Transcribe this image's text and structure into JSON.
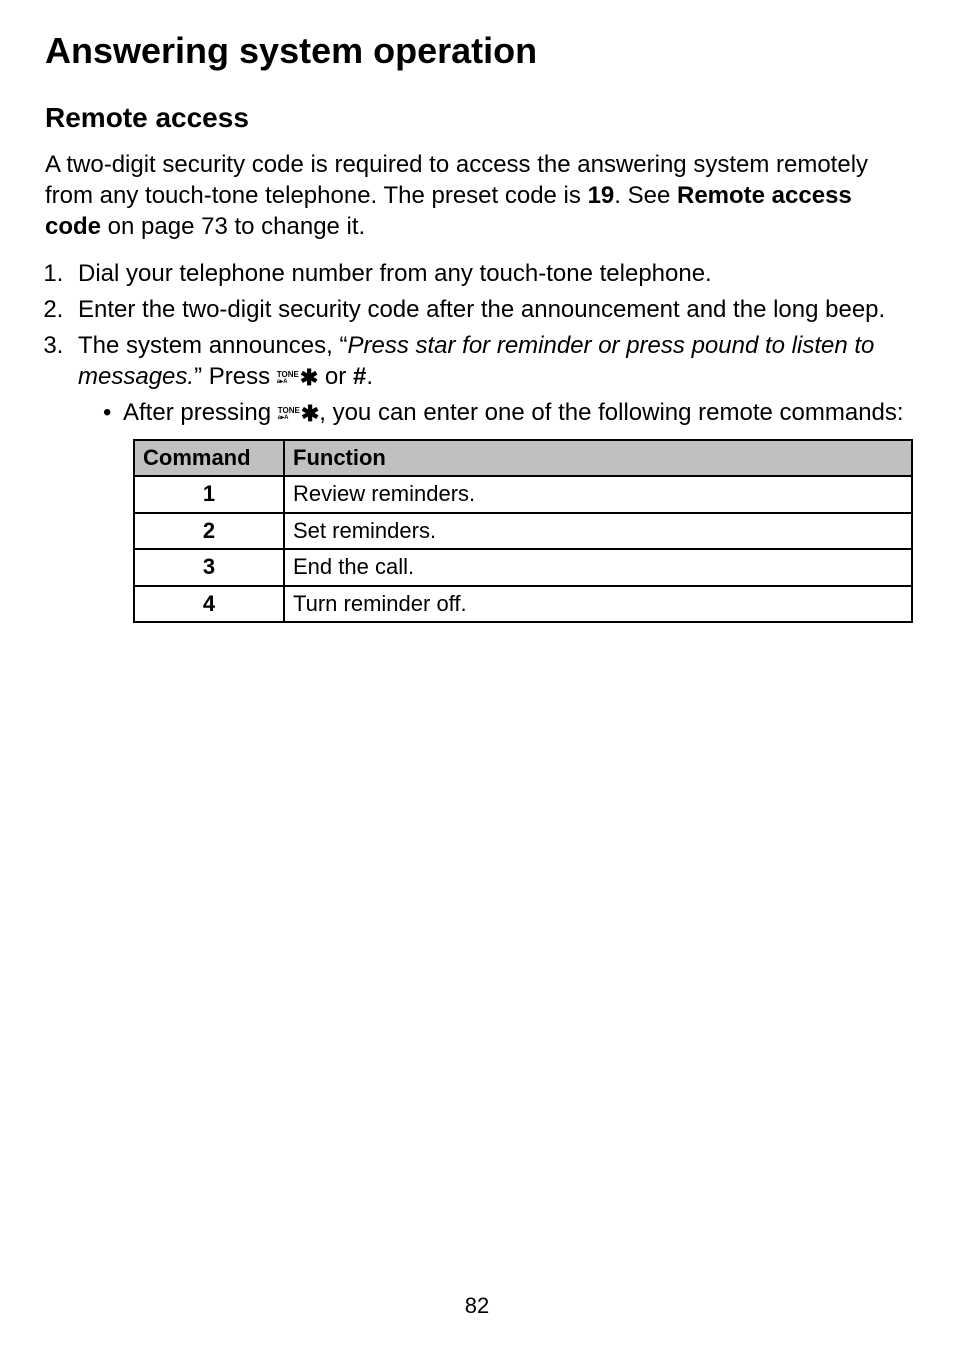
{
  "page": {
    "title": "Answering system operation",
    "number": "82"
  },
  "section": {
    "title": "Remote access",
    "intro_part1": "A two-digit security code is required to access the answering system remotely from any touch-tone telephone. The preset code is ",
    "intro_code": "19",
    "intro_part2": ". See ",
    "intro_ref": "Remote access code",
    "intro_part3": " on page 73 to change it."
  },
  "steps": {
    "1": "Dial your telephone number from any touch-tone telephone.",
    "2": "Enter the two-digit security code after the announcement and the long beep.",
    "3_part1": "The system announces, “",
    "3_italic": "Press star for reminder or press pound to listen to messages.",
    "3_part2": "” Press ",
    "3_or": " or ",
    "3_hash": "#",
    "3_period": "."
  },
  "bullet": {
    "part1": "After pressing ",
    "part2": ", you can enter one of the following remote commands:"
  },
  "key_icon": {
    "tone": "TONE",
    "ab": "a  A",
    "star": "*"
  },
  "table": {
    "header_command": "Command",
    "header_function": "Function",
    "rows": [
      {
        "cmd": "1",
        "fn": "Review reminders."
      },
      {
        "cmd": "2",
        "fn": "Set reminders."
      },
      {
        "cmd": "3",
        "fn": "End the call."
      },
      {
        "cmd": "4",
        "fn": "Turn reminder off."
      }
    ]
  },
  "chart_data": {
    "type": "table",
    "title": "Remote commands (star menu)",
    "columns": [
      "Command",
      "Function"
    ],
    "rows": [
      [
        "1",
        "Review reminders."
      ],
      [
        "2",
        "Set reminders."
      ],
      [
        "3",
        "End the call."
      ],
      [
        "4",
        "Turn reminder off."
      ]
    ]
  }
}
